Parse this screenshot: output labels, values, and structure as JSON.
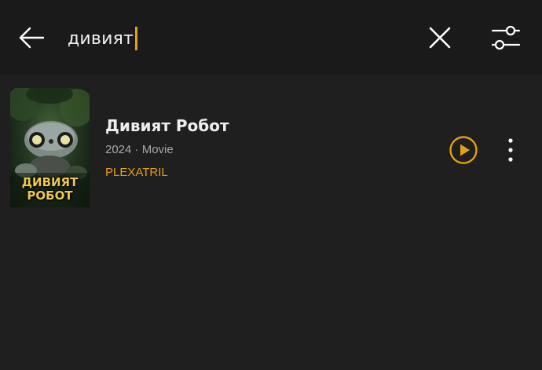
{
  "search": {
    "query": "дивият"
  },
  "results": [
    {
      "title": "Дивият Робот",
      "meta": "2024 · Movie",
      "source": "PLEXATRIL",
      "poster_text_line1": "ДИВИЯТ",
      "poster_text_line2": "РОБОТ"
    }
  ],
  "icons": {
    "back": "arrow-left-icon",
    "clear": "close-icon",
    "filter": "sliders-icon",
    "play": "play-circle-icon",
    "more": "more-vertical-icon"
  },
  "colors": {
    "accent": "#e5a00d",
    "background": "#1f1f1f",
    "topbar": "#1a1a1a"
  }
}
